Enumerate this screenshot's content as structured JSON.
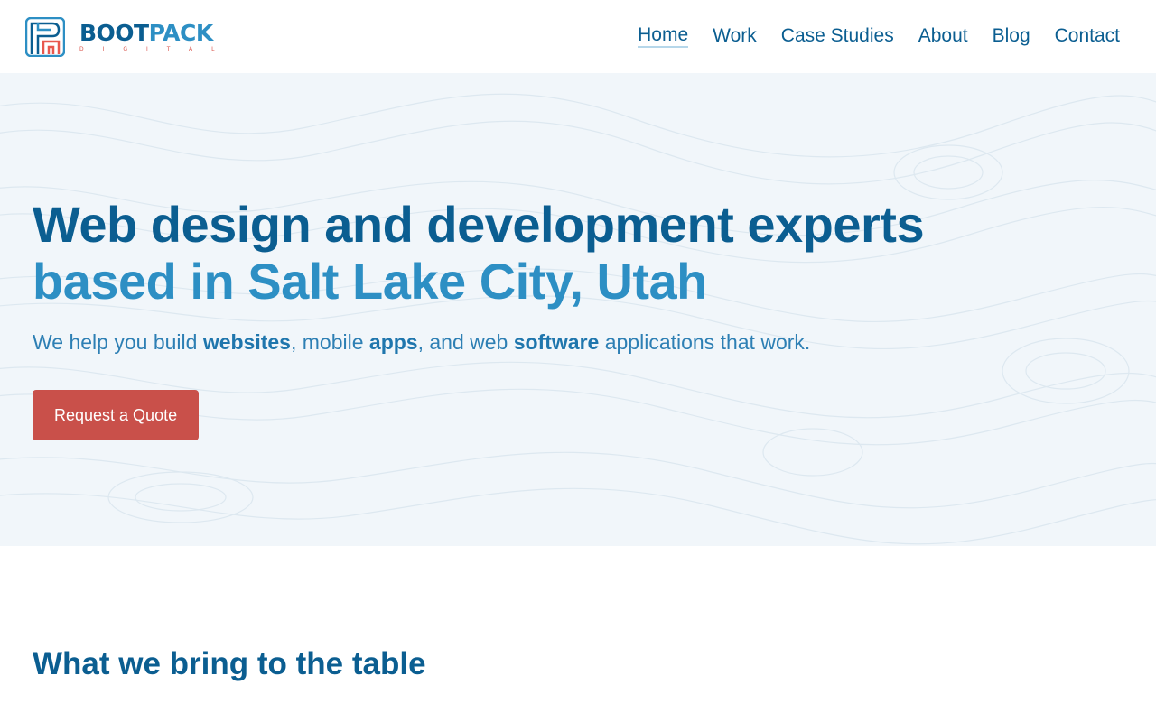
{
  "brand": {
    "name_part1": "BOOT",
    "name_part2": "PACK",
    "subtitle": "DIGITAL",
    "colors": {
      "primary": "#0b5e91",
      "secondary": "#2d8fc4",
      "accent": "#d9534a"
    }
  },
  "nav": {
    "items": [
      {
        "label": "Home",
        "active": true
      },
      {
        "label": "Work",
        "active": false
      },
      {
        "label": "Case Studies",
        "active": false
      },
      {
        "label": "About",
        "active": false
      },
      {
        "label": "Blog",
        "active": false
      },
      {
        "label": "Contact",
        "active": false
      }
    ]
  },
  "hero": {
    "title_line1": "Web design and development experts",
    "title_line2": "based in Salt Lake City, Utah",
    "subtitle": {
      "t1": "We help you build ",
      "b1": "websites",
      "t2": ", mobile ",
      "b2": "apps",
      "t3": ", and web ",
      "b3": "software",
      "t4": " applications that work."
    },
    "cta_label": "Request a Quote",
    "cta_color": "#c9504a",
    "background_pattern": "topographic-contour-lines"
  },
  "section": {
    "title": "What we bring to the table"
  }
}
